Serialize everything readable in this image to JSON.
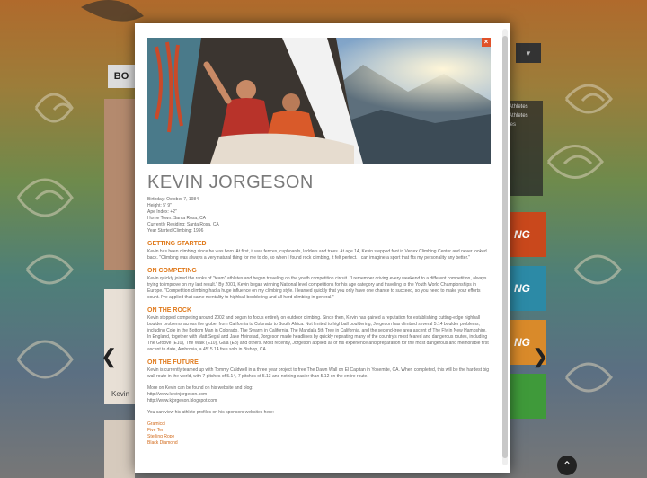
{
  "background": {
    "nav_label": "BO",
    "dropdown_label": "▾",
    "side_panel": [
      "Athletes",
      "Athletes",
      "tes"
    ],
    "tile_texts": [
      "NG",
      "NG",
      "NG"
    ],
    "card_label": "Kevin",
    "scroll_top_icon": "⌃"
  },
  "modal": {
    "close_label": "×",
    "name": "KEVIN JORGESON",
    "stats": [
      "Birthday: October 7, 1984",
      "Height: 5' 9\"",
      "Ape Index: +2\"",
      "Home Town: Santa Rosa, CA",
      "Currently Residing: Santa Rosa, CA",
      "Year Started Climbing: 1996"
    ],
    "sections": [
      {
        "heading": "GETTING STARTED",
        "text": "Kevin has been climbing since he was born. At first, it was fences, cupboards, ladders and trees. At age 14, Kevin stepped foot in Vertex Climbing Center and never looked back. \"Climbing was always a very natural thing for me to do, so when I found rock climbing, it felt perfect. I can imagine a sport that fits my personality any better.\""
      },
      {
        "heading": "ON COMPETING",
        "text": "Kevin quickly joined the ranks of \"team\" athletes and began traveling on the youth competition circuit. \"I remember driving every weekend to a different competition, always trying to improve on my last result.\" By 2001, Kevin began winning National level competitions for his age category and traveling to the Youth World Championships in Europe. \"Competition climbing had a huge influence on my climbing style. I learned quickly that you only have one chance to succeed, so you need to make your efforts count. I've applied that same mentality to highball bouldering and all hard climbing in general.\""
      },
      {
        "heading": "ON THE ROCK",
        "text": "Kevin stopped competing around 2002 and began to focus entirely on outdoor climbing. Since then, Kevin has gained a reputation for establishing cutting-edge highball boulder problems across the globe, from California to Colorado to South Africa. Not limited to highball bouldering, Jorgeson has climbed several 5.14 boulder problems, including Cole in the Bottom Man in Colorado, The Swarm in California, The Mandala 5th Tree in California, and the second-tree area ascent of The Fly in New Hampshire. In England, together with Matt Segal and Jake Heinstad, Jorgeson made headlines by quickly repeating many of the country's most feared and dangerous routes, including The Groove (E10), The Walk (E10), Gaia (E8) and others. Most recently, Jorgeson applied all of his experience and preparation for the most dangerous and memorable first ascent to date, Ambrosia, a 45' 5.14 free solo in Bishop, CA."
      },
      {
        "heading": "ON THE FUTURE",
        "text": "Kevin is currently teamed up with Tommy Caldwell in a three year project to free The Dawn Wall on El Capitan in Yosemite, CA. When completed, this will be the hardest big wall route in the world, with 7 pitches of 5.14, 7 pitches of 5.13 and nothing easier than 5.12 on the entire route."
      }
    ],
    "more_intro": "More on Kevin can be found on his website and blog:",
    "website_links": [
      "http://www.kevinjorgeson.com",
      "http://www.kjorgeson.blogspot.com"
    ],
    "sponsors_intro": "You can view his athlete profiles on his sponsors websites here:",
    "sponsor_links": [
      "Gramicci",
      "Five Ten",
      "Sterling Rope",
      "Black Diamond"
    ]
  }
}
